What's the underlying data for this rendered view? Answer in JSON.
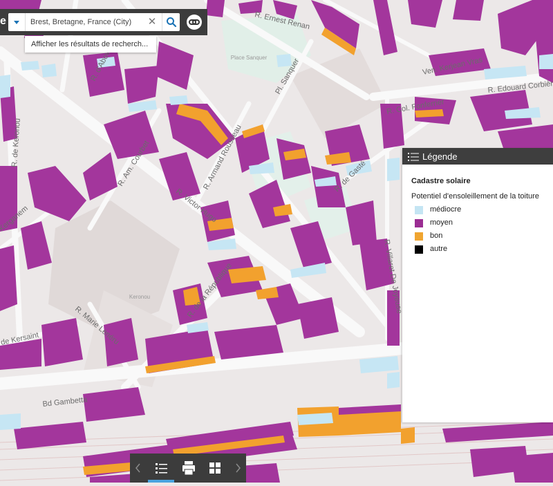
{
  "header": {
    "brand_fragment": "e"
  },
  "search": {
    "value": "Brest, Bretagne, France (City)",
    "suggestion": "Afficher les résultats de recherch..."
  },
  "map": {
    "streets": [
      "R. Ernest Renan",
      "R. d'Aboville",
      "Pl. Sanquer",
      "Ven. Kerjean Vras",
      "R. Edouard Corbière",
      "R. de Keronou",
      "R. Am. Courbet",
      "R. Armand Rousseau",
      "R. de Gasté",
      "R. Victor Hugo",
      "R. Villaret De Joyeuse",
      "R. de la République",
      "R. Marie Lenéru",
      "de Kersaint",
      "Bd Gambetta",
      "R. Col. Fonferrier",
      "Kerganem"
    ],
    "places": [
      "Place Sanquer",
      "Keronou"
    ]
  },
  "legend": {
    "header": "Légende",
    "layer_title": "Cadastre solaire",
    "subtitle": "Potentiel d'ensoleillement de la toiture",
    "items": [
      {
        "label": "médiocre",
        "color": "#c4e5f3"
      },
      {
        "label": "moyen",
        "color": "#9b2d93"
      },
      {
        "label": "bon",
        "color": "#f0a530"
      },
      {
        "label": "autre",
        "color": "#000000"
      }
    ]
  },
  "colors": {
    "building_moyen": "#a3369c",
    "building_bon": "#f2a12e",
    "building_mediocre": "#c6e6f4",
    "road": "#f8f8f8",
    "park": "#e3f0ea",
    "toolbar": "#3c3c3c",
    "accent": "#1a73b5"
  },
  "toolbar": {
    "icons": [
      "chevron-left-icon",
      "legend-list-icon",
      "print-icon",
      "grid-icon",
      "chevron-right-icon"
    ]
  }
}
